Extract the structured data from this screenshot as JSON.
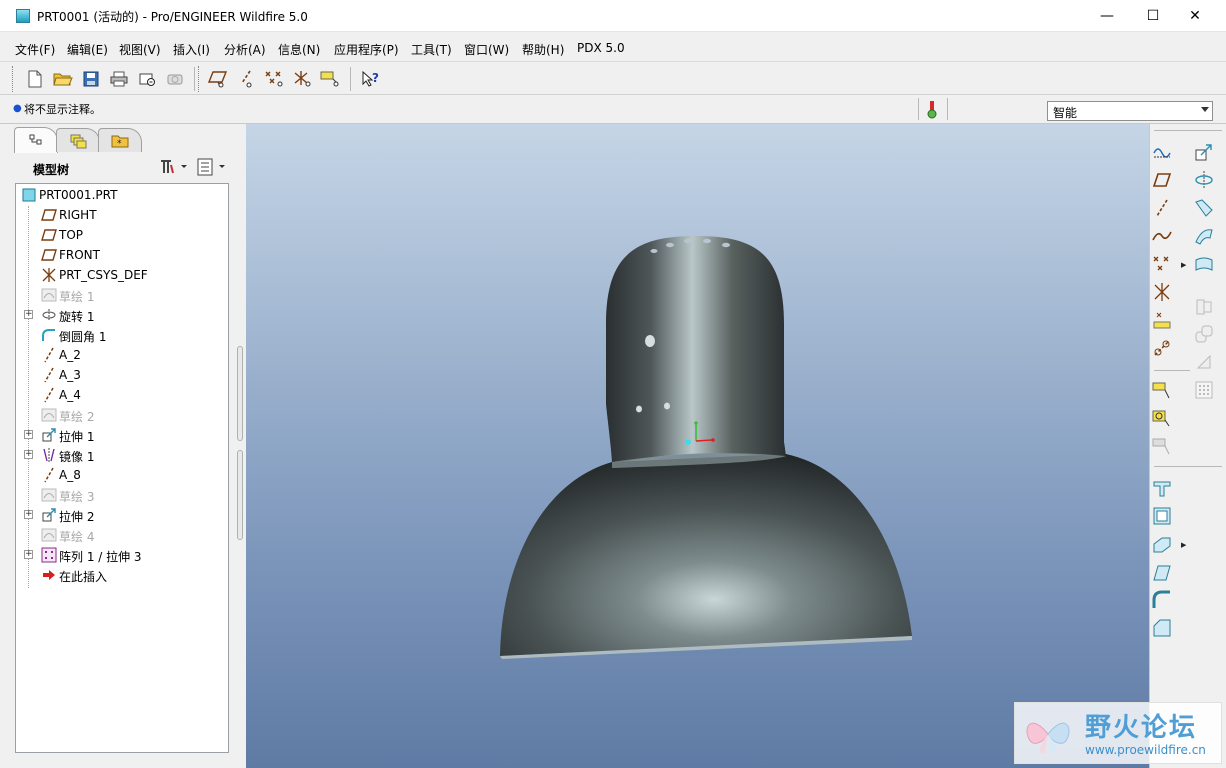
{
  "window": {
    "title": "PRT0001 (活动的) - Pro/ENGINEER Wildfire 5.0",
    "minimize_glyph": "—",
    "maximize_glyph": "☐",
    "close_glyph": "✕"
  },
  "menu": [
    {
      "label": "文件(F)"
    },
    {
      "label": "编辑(E)"
    },
    {
      "label": "视图(V)"
    },
    {
      "label": "插入(I)"
    },
    {
      "label": "分析(A)"
    },
    {
      "label": "信息(N)"
    },
    {
      "label": "应用程序(P)"
    },
    {
      "label": "工具(T)"
    },
    {
      "label": "窗口(W)"
    },
    {
      "label": "帮助(H)"
    },
    {
      "label": "PDX 5.0"
    }
  ],
  "toolbar": {
    "icons": [
      "new-file-icon",
      "open-folder-icon",
      "save-icon",
      "print-icon",
      "send-mail-icon",
      "close-window-icon",
      "datum-plane-display-icon",
      "datum-axis-display-icon",
      "datum-point-display-icon",
      "csys-display-icon",
      "annotation-display-icon",
      "context-help-icon"
    ]
  },
  "status": {
    "message": "将不显示注释。",
    "filter_value": "智能"
  },
  "model_tree": {
    "title": "模型树",
    "tabs": [
      "model-tree-tab",
      "layer-tree-tab",
      "favorites-tab"
    ],
    "items": [
      {
        "label": "PRT0001.PRT",
        "icon": "part-icon",
        "dim": false,
        "expandable": false,
        "indent": 0
      },
      {
        "label": "RIGHT",
        "icon": "datum-plane-icon",
        "dim": false,
        "expandable": false,
        "indent": 1
      },
      {
        "label": "TOP",
        "icon": "datum-plane-icon",
        "dim": false,
        "expandable": false,
        "indent": 1
      },
      {
        "label": "FRONT",
        "icon": "datum-plane-icon",
        "dim": false,
        "expandable": false,
        "indent": 1
      },
      {
        "label": "PRT_CSYS_DEF",
        "icon": "coordinate-system-icon",
        "dim": false,
        "expandable": false,
        "indent": 1
      },
      {
        "label": "草绘 1",
        "icon": "sketch-icon",
        "dim": true,
        "expandable": false,
        "indent": 1
      },
      {
        "label": "旋转 1",
        "icon": "revolve-icon",
        "dim": false,
        "expandable": true,
        "indent": 1
      },
      {
        "label": "倒圆角 1",
        "icon": "round-icon",
        "dim": false,
        "expandable": false,
        "indent": 1
      },
      {
        "label": "A_2",
        "icon": "datum-axis-icon",
        "dim": false,
        "expandable": false,
        "indent": 1
      },
      {
        "label": "A_3",
        "icon": "datum-axis-icon",
        "dim": false,
        "expandable": false,
        "indent": 1
      },
      {
        "label": "A_4",
        "icon": "datum-axis-icon",
        "dim": false,
        "expandable": false,
        "indent": 1
      },
      {
        "label": "草绘 2",
        "icon": "sketch-icon",
        "dim": true,
        "expandable": false,
        "indent": 1
      },
      {
        "label": "拉伸 1",
        "icon": "extrude-icon",
        "dim": false,
        "expandable": true,
        "indent": 1
      },
      {
        "label": "镜像 1",
        "icon": "mirror-icon",
        "dim": false,
        "expandable": true,
        "indent": 1
      },
      {
        "label": "A_8",
        "icon": "datum-axis-icon",
        "dim": false,
        "expandable": false,
        "indent": 1
      },
      {
        "label": "草绘 3",
        "icon": "sketch-icon",
        "dim": true,
        "expandable": false,
        "indent": 1
      },
      {
        "label": "拉伸 2",
        "icon": "extrude-icon",
        "dim": false,
        "expandable": true,
        "indent": 1
      },
      {
        "label": "草绘 4",
        "icon": "sketch-icon",
        "dim": true,
        "expandable": false,
        "indent": 1
      },
      {
        "label": "阵列 1 / 拉伸 3",
        "icon": "pattern-icon",
        "dim": false,
        "expandable": true,
        "indent": 1
      },
      {
        "label": "在此插入",
        "icon": "insert-here-arrow-icon",
        "dim": false,
        "expandable": false,
        "indent": 1
      }
    ]
  },
  "right_toolbar": {
    "icons": [
      "sketch-tool-icon",
      "datum-plane-tool-icon",
      "datum-axis-tool-icon",
      "datum-curve-tool-icon",
      "datum-point-tool-icon",
      "csys-tool-icon",
      "analysis-feature-icon",
      "publish-geometry-icon",
      "annotation-tool-icon",
      "annotation-feature-icon",
      "annotation-pending-icon",
      "extrude-tool-icon",
      "revolve-tool-icon",
      "sweep-tool-icon",
      "blend-tool-icon",
      "boundary-blend-icon",
      "style-tool-icon",
      "copy-tool-icon",
      "pattern-tool-icon",
      "hole-tool-icon",
      "shell-tool-icon",
      "rib-tool-icon",
      "draft-tool-icon",
      "round-tool-icon",
      "chamfer-tool-icon"
    ]
  },
  "watermark": {
    "title": "野火论坛",
    "url": "www.proewildfire.cn"
  }
}
